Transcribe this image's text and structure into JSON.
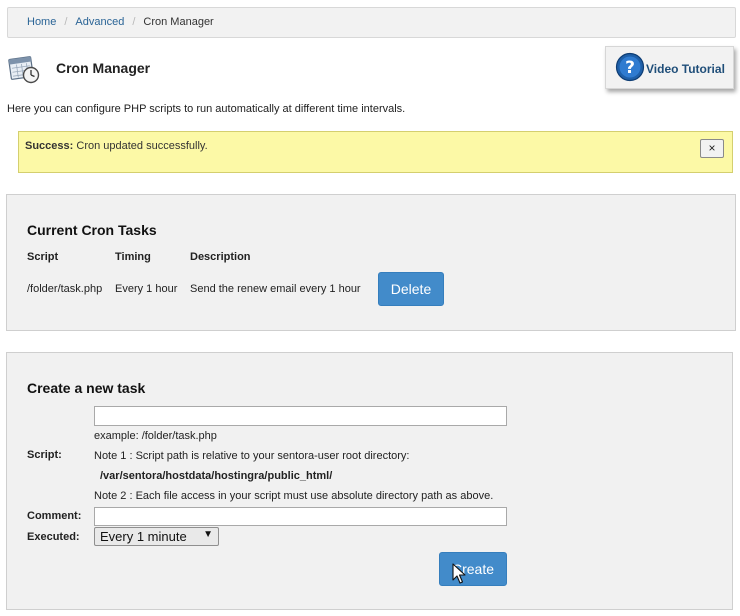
{
  "breadcrumb": {
    "items": [
      "Home",
      "Advanced"
    ],
    "separator": "/",
    "current": "Cron Manager"
  },
  "header": {
    "title": "Cron Manager",
    "icon": "calendar-clock-icon",
    "video_button": {
      "label": "Video Tutorial",
      "icon": "help-question-icon"
    }
  },
  "intro_text": "Here you can configure PHP scripts to run automatically at different time intervals.",
  "alert": {
    "strong": "Success:",
    "message": " Cron updated successfully.",
    "close_label": "×",
    "background": "#fcf9a6"
  },
  "current_tasks": {
    "title": "Current Cron Tasks",
    "headers": {
      "script": "Script",
      "timing": "Timing",
      "description": "Description"
    },
    "rows": [
      {
        "script": "/folder/task.php",
        "timing": "Every 1 hour",
        "description": "Send the renew email every 1 hour",
        "action_label": "Delete"
      }
    ]
  },
  "create_task": {
    "title": "Create a new task",
    "script_label": "Script:",
    "script_value": "",
    "example": "example: /folder/task.php",
    "note1": "Note 1 : Script path is relative to your sentora-user root directory:",
    "path": "/var/sentora/hostdata/hostingra/public_html/",
    "note2": "Note 2 : Each file access in your script must use absolute directory path as above.",
    "comment_label": "Comment:",
    "comment_value": "",
    "executed_label": "Executed:",
    "executed_value": "Every 1 minute",
    "create_label": "Create"
  },
  "colors": {
    "primary_button": "#428bca",
    "link": "#2a6496",
    "panel_bg": "#f1f1f1"
  }
}
